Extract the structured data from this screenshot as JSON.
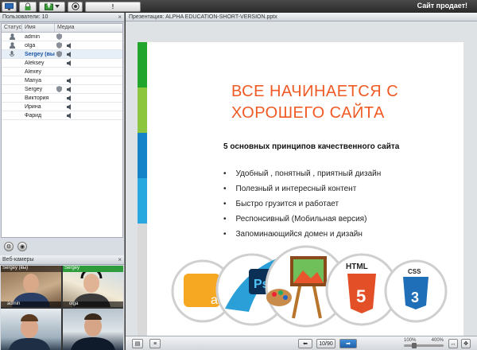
{
  "app": {
    "title": "Сайт продает!"
  },
  "toolbar": {
    "buttons": [
      {
        "name": "screen-icon"
      },
      {
        "name": "lock-icon"
      },
      {
        "name": "upload-icon"
      },
      {
        "name": "record-icon"
      },
      {
        "name": "raise-hand-icon",
        "label": "!"
      }
    ]
  },
  "users": {
    "header": "Пользователи: 10",
    "columns": [
      "Статус",
      "Имя",
      "Медиа"
    ],
    "rows": [
      {
        "name": "admin",
        "status": "user",
        "mic": true,
        "speaker": false,
        "selected": false
      },
      {
        "name": "olga",
        "status": "user",
        "mic": true,
        "speaker": true,
        "selected": false
      },
      {
        "name": "Sergey (вы)",
        "status": "mic",
        "mic": true,
        "speaker": true,
        "selected": true
      },
      {
        "name": "Aleksey",
        "status": "",
        "mic": false,
        "speaker": true,
        "selected": false
      },
      {
        "name": "Alexey",
        "status": "",
        "mic": false,
        "speaker": false,
        "selected": false
      },
      {
        "name": "Mariya",
        "status": "",
        "mic": false,
        "speaker": true,
        "selected": false
      },
      {
        "name": "Sergey",
        "status": "",
        "mic": true,
        "speaker": true,
        "selected": false
      },
      {
        "name": "Виктория",
        "status": "",
        "mic": false,
        "speaker": true,
        "selected": false
      },
      {
        "name": "Ирина",
        "status": "",
        "mic": false,
        "speaker": true,
        "selected": false
      },
      {
        "name": "Фарид",
        "status": "",
        "mic": false,
        "speaker": true,
        "selected": false
      }
    ]
  },
  "webcams": {
    "header": "Веб-камеры",
    "cams": [
      {
        "top": "Sergey (вы)",
        "bottom": "admin"
      },
      {
        "top": "Sergey",
        "bottom": "olga"
      },
      {
        "top": "",
        "bottom": ""
      },
      {
        "top": "",
        "bottom": ""
      }
    ]
  },
  "presentation": {
    "header": "Презентация: ALPHA EDUCATION-SHORT-VERSION.pptx",
    "title_line1": "ВСЕ НАЧИНАЕТСЯ С",
    "title_line2": "ХОРОШЕГО САЙТА",
    "subtitle": "5 основных принципов качественного сайта",
    "bullets": [
      "Удобный , понятный , приятный дизайн",
      "Полезный и интересный контент",
      "Быстро грузится и работает",
      "Респонсивный (Мобильная версия)",
      "Запоминающийся домен и дизайн"
    ],
    "logos": [
      "ai",
      "Ps",
      "HTML",
      "CSS"
    ],
    "colors": {
      "title": "#f05a24",
      "html5": "#e34f26",
      "css3": "#1f6fb8"
    }
  },
  "navigation": {
    "page": "10/90",
    "zoom_min": "100%",
    "zoom_max": "400%"
  }
}
